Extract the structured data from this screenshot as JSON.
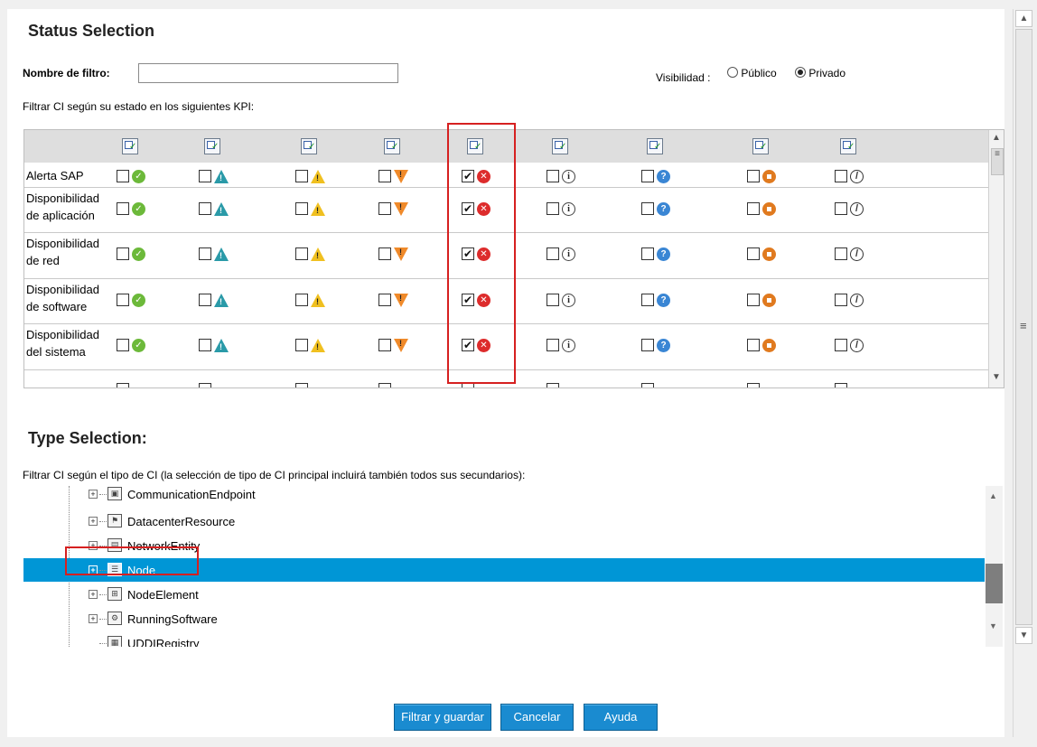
{
  "status_section": {
    "title": "Status Selection",
    "filter_name_label": "Nombre de filtro:",
    "filter_name_value": "",
    "visibility_label": "Visibilidad :",
    "visibility_options": [
      "Público",
      "Privado"
    ],
    "visibility_selected": "Privado",
    "kpi_hint": "Filtrar CI según su estado en los siguientes KPI:"
  },
  "kpi_table": {
    "status_columns": [
      {
        "icon": "ok-icon",
        "color": "#6cb93a"
      },
      {
        "icon": "warning-teal-icon",
        "color": "#2a9aa8"
      },
      {
        "icon": "warning-yellow-icon",
        "color": "#f0c020"
      },
      {
        "icon": "major-orange-icon",
        "color": "#f08a2a"
      },
      {
        "icon": "critical-icon",
        "color": "#dd2c2c"
      },
      {
        "icon": "info-icon",
        "color": "#ffffff"
      },
      {
        "icon": "unknown-icon",
        "color": "#3a86d4"
      },
      {
        "icon": "stop-icon",
        "color": "#e07a1f"
      },
      {
        "icon": "no-data-icon",
        "color": "#ffffff"
      }
    ],
    "rows": [
      {
        "label_line1": "Alerta SAP",
        "label_line2": "",
        "checked": [
          false,
          false,
          false,
          false,
          true,
          false,
          false,
          false,
          false
        ]
      },
      {
        "label_line1": "Disponibilidad",
        "label_line2": "de aplicación",
        "checked": [
          false,
          false,
          false,
          false,
          true,
          false,
          false,
          false,
          false
        ]
      },
      {
        "label_line1": "Disponibilidad",
        "label_line2": "de red",
        "checked": [
          false,
          false,
          false,
          false,
          true,
          false,
          false,
          false,
          false
        ]
      },
      {
        "label_line1": "Disponibilidad",
        "label_line2": "de software",
        "checked": [
          false,
          false,
          false,
          false,
          true,
          false,
          false,
          false,
          false
        ]
      },
      {
        "label_line1": "Disponibilidad",
        "label_line2": "del sistema",
        "checked": [
          false,
          false,
          false,
          false,
          true,
          false,
          false,
          false,
          false
        ]
      }
    ]
  },
  "type_section": {
    "title": "Type Selection:",
    "hint": "Filtrar CI según el tipo de CI (la selección de tipo de CI principal incluirá también todos sus secundarios):",
    "tree_items": [
      {
        "label": "CommunicationEndpoint",
        "icon": "endpoint-icon",
        "expander": "+",
        "selected": false
      },
      {
        "label": "DatacenterResource",
        "icon": "flag-icon",
        "expander": "+",
        "selected": false
      },
      {
        "label": "NetworkEntity",
        "icon": "network-icon",
        "expander": "+",
        "selected": false
      },
      {
        "label": "Node",
        "icon": "server-icon",
        "expander": "+",
        "selected": true
      },
      {
        "label": "NodeElement",
        "icon": "node-element-icon",
        "expander": "+",
        "selected": false
      },
      {
        "label": "RunningSoftware",
        "icon": "gear-icon",
        "expander": "+",
        "selected": false
      },
      {
        "label": "UDDIRegistry",
        "icon": "registry-icon",
        "expander": "",
        "selected": false
      }
    ]
  },
  "buttons": {
    "filter_save": "Filtrar y guardar",
    "cancel": "Cancelar",
    "help": "Ayuda"
  }
}
